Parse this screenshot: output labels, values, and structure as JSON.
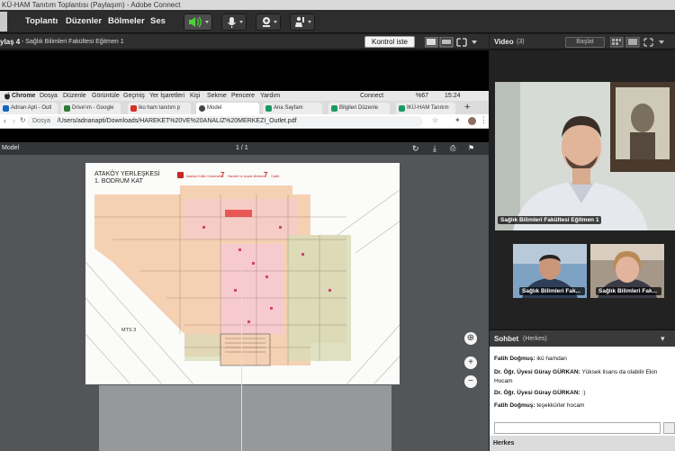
{
  "window": {
    "title": "KÜ-HAM Tanıtım Toplantısı (Paylaşım) - Adobe Connect"
  },
  "menubar": {
    "items": [
      "Toplantı",
      "Düzenler",
      "Bölmeler",
      "Ses"
    ]
  },
  "share_pod": {
    "title": "ylaş 4",
    "presenter": "- Sağlık Bilimleri Fakültesi Eğitmen 1",
    "stop_label": "Kontrol iste"
  },
  "mac_menubar": {
    "items": [
      "Chrome",
      "Dosya",
      "Düzenle",
      "Görüntüle",
      "Geçmiş",
      "Yer İşaretleri",
      "Kişi",
      "Sekme",
      "Pencere",
      "Yardım"
    ],
    "right": "Connect",
    "battery": "%67",
    "time": "15:24"
  },
  "browser": {
    "tabs": [
      "Adnan Apti - Outl",
      "Drive'ım - Google",
      "iku ham tanıtım p",
      "Model",
      "Ana Sayfam",
      "Bilgileri Düzenle",
      "İKÜ-HAM Tanıtım"
    ],
    "url_prefix": "Dosya",
    "url": "/Users/adnanapti/Downloads/HAREKET%20VE%20ANALIZ%20MERKEZI_Outlet.pdf"
  },
  "pdf_viewer": {
    "filename": "Model",
    "page": "1 / 1",
    "page_title_1": "ATAKÖY YERLEŞKESİ",
    "page_title_2": "1. BODRUM KAT",
    "label_mts": "MTS 3",
    "logos": [
      "İstanbul Kültür Üniversitesi",
      "Hareket ve Analiz Merkezi",
      "Outlet"
    ]
  },
  "video_pod": {
    "title": "Video",
    "count": "(3)",
    "start_label": "Başlat",
    "participants": [
      "Sağlık Bilimleri Fakültesi Eğitmen 1",
      "Sağlık Bilimleri Fak...",
      "Sağlık Bilimleri Fak..."
    ]
  },
  "chat_pod": {
    "title": "Sohbet",
    "scope": "(Herkes)",
    "messages": [
      {
        "sender": "Fatih Doğmuş:",
        "text": "ikü hamdan"
      },
      {
        "sender": "Dr. Öğr. Üyesi Güray GÜRKAN:",
        "text": "Yüksek lisans da olabilir Ekin Hocam"
      },
      {
        "sender": "Dr. Öğr. Üyesi Güray GÜRKAN:",
        "text": ":)"
      },
      {
        "sender": "Fatih Doğmuş:",
        "text": "teşekkürler hocam"
      }
    ],
    "footer": "Herkes"
  },
  "colors": {
    "chrome_red": "#d93025",
    "floorplan_orange": "#f3c9a8",
    "floorplan_pink": "#f6c8d6",
    "floorplan_green": "#d8dcb8"
  }
}
